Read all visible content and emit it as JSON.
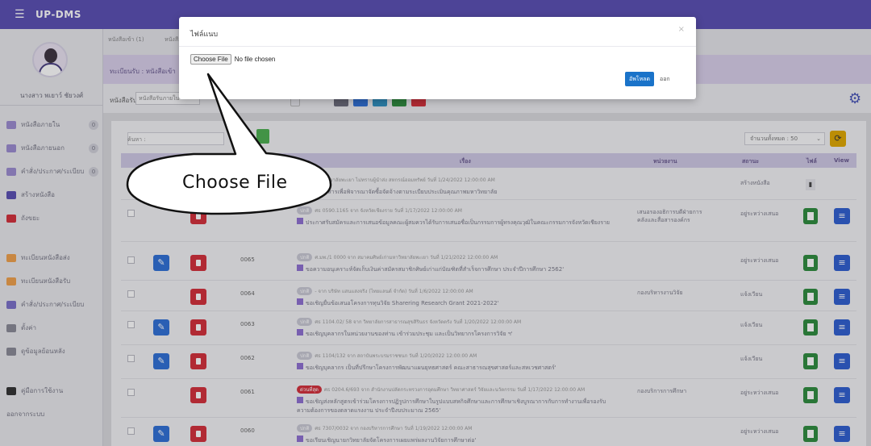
{
  "app": {
    "title": "UP-DMS"
  },
  "sidebar": {
    "user_name": "นางสาว พเยาว์ ชัยวงศ์",
    "items": [
      {
        "label": "หนังสือภายใน",
        "badge": "0",
        "color": "#9b8bd0"
      },
      {
        "label": "หนังสือภายนอก",
        "badge": "0",
        "color": "#9b8bd0"
      },
      {
        "label": "คำสั่ง/ประกาศ/ระเบียบ",
        "badge": "0",
        "color": "#9b8bd0"
      },
      {
        "label": "สร้างหนังสือ",
        "badge": "",
        "color": "#5a4fb3"
      },
      {
        "label": "ถังขยะ",
        "badge": "",
        "color": "#d32f3a"
      },
      {
        "label": "ทะเบียนหนังสือส่ง",
        "badge": "",
        "color": "#f0a04b"
      },
      {
        "label": "ทะเบียนหนังสือรับ",
        "badge": "",
        "color": "#f0a04b"
      },
      {
        "label": "คำสั่ง/ประกาศ/ระเบียบ",
        "badge": "",
        "color": "#7a6fc9"
      },
      {
        "label": "ตั้งค่า",
        "badge": "",
        "color": "#8a8a96"
      },
      {
        "label": "ดูข้อมูลย้อนหลัง",
        "badge": "",
        "color": "#8a8a96"
      },
      {
        "label": "คู่มือการใช้งาน",
        "badge": "",
        "color": "#333333"
      },
      {
        "label": "ออกจากระบบ",
        "badge": "",
        "color": ""
      }
    ]
  },
  "tabs": {
    "t1": "หนังสือเข้า",
    "t1_badge": "1",
    "t2": "หนังสือ"
  },
  "header": {
    "breadcrumb": "ทะเบียนรับ : หนังสือเข้า"
  },
  "filter": {
    "label": "หนังสือรับ :",
    "select": "หนังสือรับภายใน"
  },
  "list": {
    "search_label": "ค้นหา :",
    "per_page": "จำนวนทั้งหมด : 50",
    "columns": {
      "subject": "เรื่อง",
      "agency": "หน่วยงาน",
      "status": "สถานะ",
      "file": "ไฟล์",
      "view": "View"
    },
    "rows": [
      {
        "num": "",
        "line1": "มหาวิทยาลัยพะเยา ไม่ทราบผู้นำส่ง สหกรณ์ออมทรัพย์ วันที่ 1/24/2022 12:00:00 AM",
        "line2": "ขอส่งเอกสารเพื่อพิจารณาจัดซื้อจัดจ้างตามระเบียบประเมินคุณภาพมหาวิทยาลัย",
        "line3": "",
        "agency": "",
        "status": "สร้างหนังสือ",
        "edit": false,
        "file_plain": true
      },
      {
        "num": "",
        "line1": "ศธ 0590.1165 จาก จังหวัดเชียงราย วันที่ 1/17/2022 12:00:00 AM",
        "line2": "ประกาศรับสมัครและการเสนอข้อมูลคณะผู้สมควรได้รับการเสนอชื่อเป็นกรรมการผู้ทรงคุณวุฒิในคณะกรรมการจังหวัดเชียงราย",
        "line3": "",
        "agency": "เสนอรองอธิการบดีฝ่ายการคลังและสื่อสารองค์กร",
        "status": "อยู่ระหว่างเสนอ",
        "edit": false,
        "file_plain": false
      },
      {
        "num": "0065",
        "line1": "ศ.มพ./1 0000 จาก สมาคมศิษย์เก่ามหาวิทยาลัยพะเยา วันที่ 1/21/2022 12:00:00 AM",
        "line2": "ขอความอนุเคราะห์จัดเก็บเงินค่าสมัครสมาชิกศิษย์เก่าแก่บัณฑิตที่สำเร็จการศึกษา ประจำปีการศึกษา 2562'",
        "line3": "",
        "agency": "",
        "status": "อยู่ระหว่างเสนอ",
        "edit": true,
        "file_plain": false
      },
      {
        "num": "0064",
        "line1": "- จาก บริษัท แสนแสงจริง (ไทยแลนด์ จำกัด) วันที่ 1/6/2022 12:00:00 AM",
        "line2": "ขอเชิญยื่นข้อเสนอโครงการทุนวิจัย Sharering Research Grant 2021-2022'",
        "line3": "",
        "agency": "กองบริหารงานวิจัย",
        "status": "แจ้งเวียน",
        "edit": false,
        "file_plain": false
      },
      {
        "num": "0063",
        "line1": "ศธ 1104.02/ 58 จาก วิทยาลัยการสาธารณสุขสิรินธร จังหวัดตรัง วันที่ 1/20/2022 12:00:00 AM",
        "line2": "ขอเชิญบุคลากรในหน่วยงานของท่าน เข้าร่วมประชุม และเป็นวิทยากรโครงการวิจัย ฯ'",
        "line3": "",
        "agency": "",
        "status": "แจ้งเวียน",
        "edit": true,
        "file_plain": false
      },
      {
        "num": "0062",
        "line1": "ศธ 1104/132 จาก สถาบันพระบรมราชชนก วันที่ 1/20/2022 12:00:00 AM",
        "line2": "ขอเชิญบุคลากร เป็นที่ปรึกษาโครงการพัฒนาแผนยุทธศาสตร์ คณะสาธารณสุขศาสตร์และสหเวชศาสตร์'",
        "line3": "",
        "agency": "",
        "status": "แจ้งเวียน",
        "edit": true,
        "file_plain": false
      },
      {
        "num": "0061",
        "line1": "ศธ 0204.6/693 จาก สำนักงานปลัดกระทรวงการอุดมศึกษา วิทยาศาสตร์ วิจัยและนวัตกรรม วันที่ 1/17/2022 12:00:00 AM",
        "line2": "ขอเชิญส่งหลักสูตรเข้าร่วมโครงการปฏิรูปการศึกษาในรูปแบบสหกิจศึกษาและการศึกษาเชิงบูรณาการกับการทำงานเพื่อรองรับ",
        "line3": "ความต้องการของตลาดแรงงาน ประจำปีงบประมาณ 2565'",
        "agency": "กองบริการการศึกษา",
        "status": "อยู่ระหว่างเสนอ",
        "edit": false,
        "file_plain": false,
        "urgent": "ด่วนที่สุด"
      },
      {
        "num": "0060",
        "line1": "ศธ 7307/0032 จาก กองบริหารการศึกษา วันที่ 1/19/2022 12:00:00 AM",
        "line2": "ขอเรียนเชิญนายกวิทยาลัยจัดโครงการเผยแพร่ผลงานวิจัยการศึกษาต่อ'",
        "line3": "",
        "agency": "",
        "status": "อยู่ระหว่างเสนอ",
        "edit": true,
        "file_plain": false
      }
    ],
    "pill_text": "ปกติ"
  },
  "modal": {
    "title": "ไฟล์แนบ",
    "close": "×",
    "choose_label": "Choose File",
    "file_status": "No file chosen",
    "upload_label": "อัพโหลด",
    "exit_label": "ออก"
  },
  "callout": {
    "text": "Choose File"
  }
}
